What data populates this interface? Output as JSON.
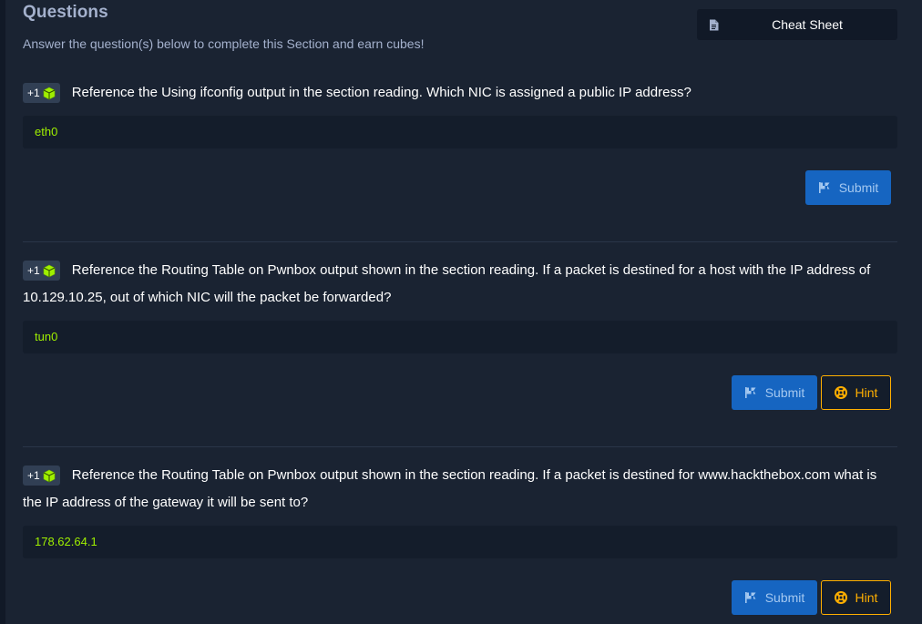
{
  "header": {
    "title": "Questions",
    "subtitle": "Answer the question(s) below to complete this Section and earn cubes!",
    "cheat_sheet_label": "Cheat Sheet"
  },
  "colors": {
    "panel_bg": "#1a2332",
    "input_bg": "#141d2b",
    "accent_green": "#9fef00",
    "submit_blue": "#1665c1",
    "hint_orange": "#ffaf00"
  },
  "questions": [
    {
      "badge": "+1",
      "badge_icon": "cube-icon",
      "text": "Reference the Using ifconfig output in the section reading. Which NIC is assigned a public IP address?",
      "answer": "eth0",
      "submit_label": "Submit",
      "hint_label": null
    },
    {
      "badge": "+1",
      "badge_icon": "cube-icon",
      "text": "Reference the Routing Table on Pwnbox output shown in the section reading. If a packet is destined for a host with the IP address of 10.129.10.25, out of which NIC will the packet be forwarded?",
      "answer": "tun0",
      "submit_label": "Submit",
      "hint_label": "Hint"
    },
    {
      "badge": "+1",
      "badge_icon": "cube-icon",
      "text": "Reference the Routing Table on Pwnbox output shown in the section reading. If a packet is destined for www.hackthebox.com what is the IP address of the gateway it will be sent to?",
      "answer": "178.62.64.1",
      "submit_label": "Submit",
      "hint_label": "Hint"
    }
  ]
}
